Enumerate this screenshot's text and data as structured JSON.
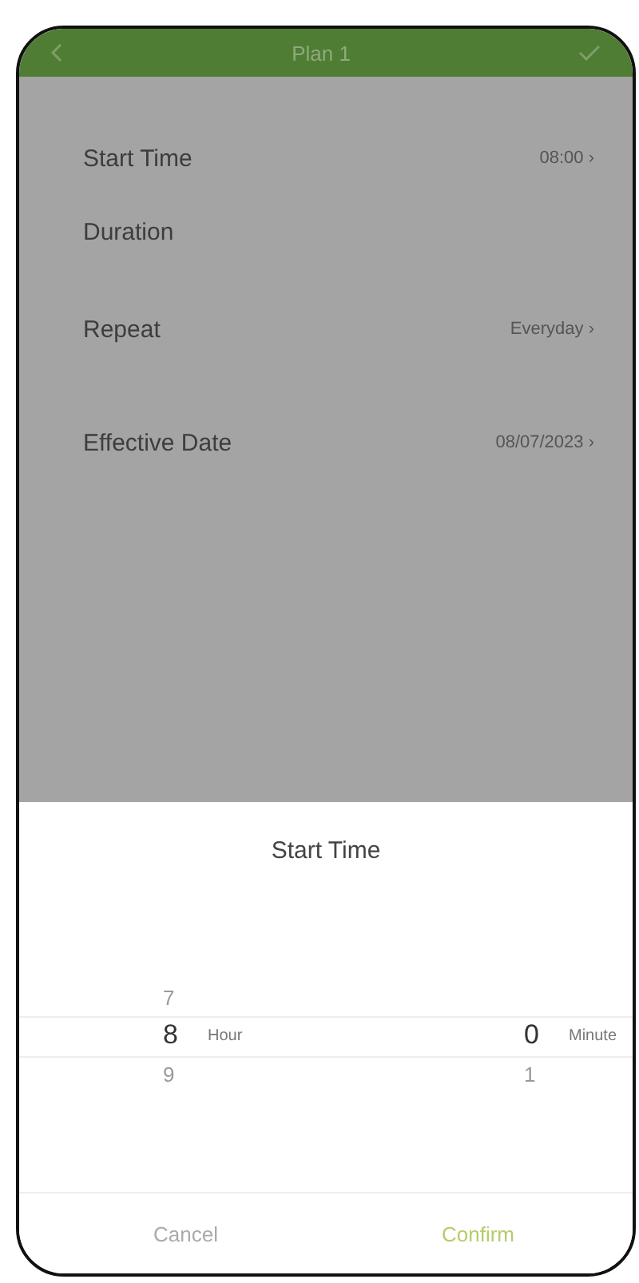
{
  "header": {
    "title": "Plan 1"
  },
  "settings": [
    {
      "label": "Start Time",
      "value": "08:00",
      "chevron": "›"
    },
    {
      "label": "Duration"
    },
    {
      "label": "Repeat",
      "value": "Everyday",
      "chevron": "›"
    },
    {
      "label": "Effective Date",
      "value": "08/07/2023",
      "chevron": "›"
    }
  ],
  "sheet": {
    "title": "Start Time",
    "columns": [
      {
        "unit": "Hour",
        "items": [
          {
            "value": "7",
            "selected": false
          },
          {
            "value": "8",
            "selected": true
          },
          {
            "value": "9",
            "selected": false
          }
        ]
      },
      {
        "unit": "Minute",
        "items": [
          {
            "value": "0",
            "selected": true
          },
          {
            "value": "1",
            "selected": false
          }
        ]
      }
    ],
    "buttons": [
      {
        "label": "Cancel",
        "kind": "cancel"
      },
      {
        "label": "Confirm",
        "kind": "confirm"
      }
    ]
  }
}
